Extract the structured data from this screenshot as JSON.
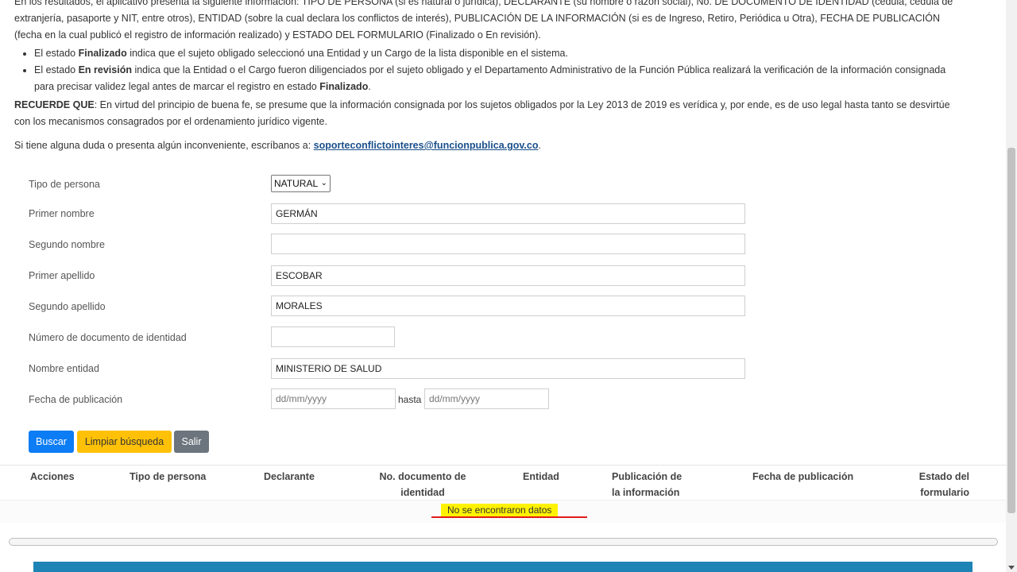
{
  "intro": {
    "line1": "En los resultados, el aplicativo presenta la siguiente información: TIPO DE PERSONA (si es natural o jurídica), DECLARANTE (su nombre o razón social), No. DE DOCUMENTO DE IDENTIDAD (cédula, cédula de extranjería, pasaporte y NIT, entre otros), ENTIDAD (sobre la cual declara los conflictos de interés), PUBLICACIÓN DE LA INFORMACIÓN (si es de Ingreso, Retiro, Periódica u Otra), FECHA DE PUBLICACIÓN (fecha en la cual publicó el registro de información realizado) y ESTADO DEL FORMULARIO (Finalizado o En revisión).",
    "bullet1_pre": "El estado ",
    "bullet1_bold": "Finalizado",
    "bullet1_post": " indica que el sujeto obligado seleccionó una Entidad y un Cargo de la lista disponible en el sistema.",
    "bullet2_pre": "El estado ",
    "bullet2_bold": "En revisión",
    "bullet2_mid": " indica que la Entidad o el Cargo fueron diligenciados por el sujeto obligado y el Departamento Administrativo de la Función Pública realizará la verificación de la información consignada para precisar validez legal antes de marcar el registro en estado ",
    "bullet2_bold2": "Finalizado",
    "bullet2_end": ".",
    "recuerde_label": "RECUERDE QUE",
    "recuerde_text": ": En virtud del principio de buena fe, se presume que la información consignada por los sujetos obligados por la Ley 2013 de 2019 es verídica y, por ende, es de uso legal hasta tanto se desvirtúe con los mecanismos consagrados por el ordenamiento jurídico vigente.",
    "contact_text": "Si tiene alguna duda o presenta algún inconveniente, escríbanos a: ",
    "contact_email": "soporteconflictointeres@funcionpublica.gov.co",
    "contact_end": "."
  },
  "form": {
    "tipo_persona": {
      "label": "Tipo de persona",
      "value": "NATURAL"
    },
    "primer_nombre": {
      "label": "Primer nombre",
      "value": "GERMÁN"
    },
    "segundo_nombre": {
      "label": "Segundo nombre",
      "value": ""
    },
    "primer_apellido": {
      "label": "Primer apellido",
      "value": "ESCOBAR"
    },
    "segundo_apellido": {
      "label": "Segundo apellido",
      "value": "MORALES"
    },
    "documento": {
      "label": "Número de documento de identidad",
      "value": ""
    },
    "entidad": {
      "label": "Nombre entidad",
      "value": "MINISTERIO DE SALUD"
    },
    "fecha": {
      "label": "Fecha de publicación",
      "from_placeholder": "dd/mm/yyyy",
      "hasta": "hasta",
      "to_placeholder": "dd/mm/yyyy"
    }
  },
  "buttons": {
    "buscar": "Buscar",
    "limpiar": "Limpiar búsqueda",
    "salir": "Salir"
  },
  "table": {
    "headers": {
      "acciones": "Acciones",
      "tipo": "Tipo de persona",
      "declarante": "Declarante",
      "documento_l1": "No. documento de",
      "documento_l2": "identidad",
      "entidad": "Entidad",
      "publicacion_l1": "Publicación de",
      "publicacion_l2": "la información",
      "fecha": "Fecha de publicación",
      "estado_l1": "Estado del",
      "estado_l2": "formulario"
    },
    "empty_message": "No se encontraron datos"
  },
  "colors": {
    "buscar": "#0d7df5",
    "limpiar": "#ffc107",
    "salir": "#6c757d",
    "highlight": "#fff200",
    "annotation_line": "#e21b1b",
    "footer": "#1d84b5",
    "link": "#1a4f8b"
  }
}
